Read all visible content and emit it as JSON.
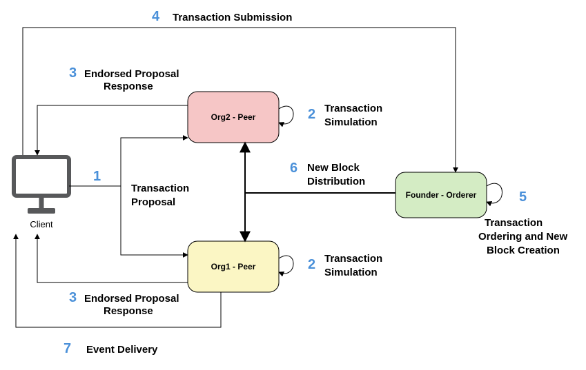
{
  "nodes": {
    "client": "Client",
    "org2peer": "Org2 - Peer",
    "org1peer": "Org1 - Peer",
    "orderer": "Founder - Orderer"
  },
  "steps": {
    "s1": {
      "n": "1",
      "t": "Transaction",
      "t2": "Proposal"
    },
    "s2a": {
      "n": "2",
      "t": "Transaction",
      "t2": "Simulation"
    },
    "s2b": {
      "n": "2",
      "t": "Transaction",
      "t2": "Simulation"
    },
    "s3a": {
      "n": "3",
      "t": "Endorsed Proposal",
      "t2": "Response"
    },
    "s3b": {
      "n": "3",
      "t": "Endorsed Proposal",
      "t2": "Response"
    },
    "s4": {
      "n": "4",
      "t": "Transaction Submission"
    },
    "s5": {
      "n": "5",
      "t": "Transaction",
      "t2": "Ordering and New",
      "t3": "Block Creation"
    },
    "s6": {
      "n": "6",
      "t": "New Block",
      "t2": "Distribution"
    },
    "s7": {
      "n": "7",
      "t": "Event Delivery"
    }
  }
}
